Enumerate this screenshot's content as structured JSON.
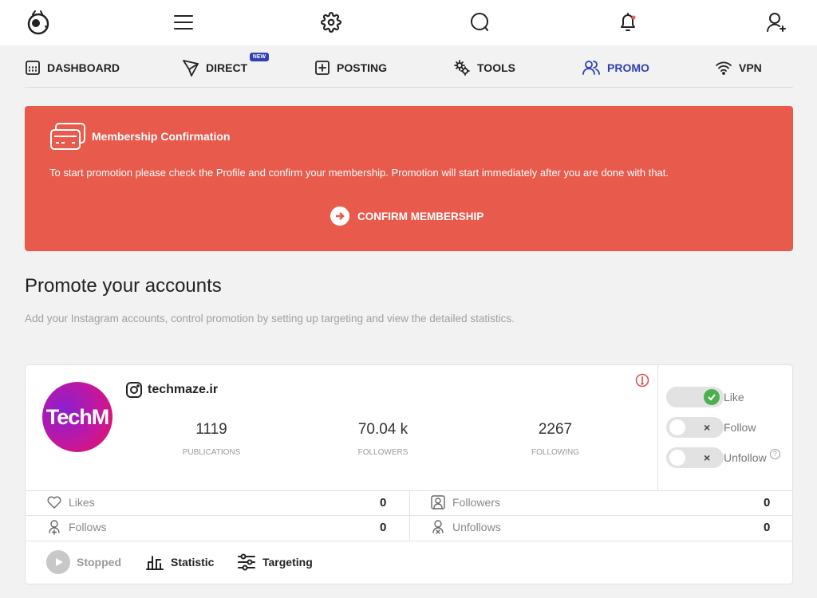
{
  "topbar": {
    "icons": [
      "logo-icon",
      "menu-icon",
      "settings-icon",
      "chat-icon",
      "bell-icon",
      "add-user-icon"
    ],
    "notification_dot_color": "#e85a4c"
  },
  "nav": {
    "items": [
      {
        "label": "DASHBOARD",
        "icon": "dashboard-icon"
      },
      {
        "label": "DIRECT",
        "icon": "send-icon",
        "badge": "NEW"
      },
      {
        "label": "POSTING",
        "icon": "plus-square-icon"
      },
      {
        "label": "TOOLS",
        "icon": "tools-icon"
      },
      {
        "label": "PROMO",
        "icon": "users-icon",
        "active": true
      },
      {
        "label": "VPN",
        "icon": "wifi-icon"
      }
    ],
    "active_color": "#2f3fb4"
  },
  "alert": {
    "title": "Membership Confirmation",
    "text": "To start promotion please check the Profile and confirm your membership. Promotion will start immediately after you are done with that.",
    "button": "CONFIRM MEMBERSHIP",
    "color": "#e85a4c"
  },
  "section": {
    "title": "Promote your accounts",
    "subtitle": "Add your Instagram accounts, control promotion by setting up targeting and view the detailed statistics."
  },
  "account": {
    "avatar_text": "TechM",
    "username": "techmaze.ir",
    "stats": [
      {
        "value": "1119",
        "label": "PUBLICATIONS"
      },
      {
        "value": "70.04 k",
        "label": "FOLLOWERS"
      },
      {
        "value": "2267",
        "label": "FOLLOWING"
      }
    ],
    "toggles": [
      {
        "label": "Like",
        "on": true
      },
      {
        "label": "Follow",
        "on": false
      },
      {
        "label": "Unfollow",
        "on": false,
        "help": "?"
      }
    ],
    "metrics": {
      "likes": {
        "label": "Likes",
        "value": "0"
      },
      "followers": {
        "label": "Followers",
        "value": "0"
      },
      "follows": {
        "label": "Follows",
        "value": "0"
      },
      "unfollows": {
        "label": "Unfollows",
        "value": "0"
      }
    },
    "footer": {
      "status": "Stopped",
      "statistic": "Statistic",
      "targeting": "Targeting"
    }
  }
}
